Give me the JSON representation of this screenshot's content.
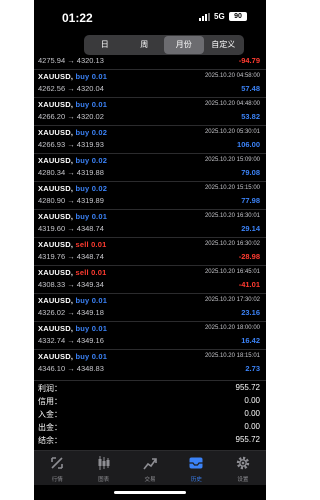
{
  "status_bar": {
    "time": "01:22",
    "network": "5G",
    "battery": "90"
  },
  "period_tabs": [
    {
      "label": "日",
      "active": false
    },
    {
      "label": "周",
      "active": false
    },
    {
      "label": "月份",
      "active": true
    },
    {
      "label": "自定义",
      "active": false
    }
  ],
  "top_partial": {
    "price": "4275.94 → 4320.13",
    "profit": "-94.79"
  },
  "trades": [
    {
      "symbol": "XAUUSD,",
      "side": "buy",
      "lot": "0.01",
      "date": "2025.10.20 04:58:00",
      "prices": "4262.56 → 4320.04",
      "profit": "57.48"
    },
    {
      "symbol": "XAUUSD,",
      "side": "buy",
      "lot": "0.01",
      "date": "2025.10.20 04:48:00",
      "prices": "4266.20 → 4320.02",
      "profit": "53.82"
    },
    {
      "symbol": "XAUUSD,",
      "side": "buy",
      "lot": "0.02",
      "date": "2025.10.20 05:30:01",
      "prices": "4266.93 → 4319.93",
      "profit": "106.00"
    },
    {
      "symbol": "XAUUSD,",
      "side": "buy",
      "lot": "0.02",
      "date": "2025.10.20 15:09:00",
      "prices": "4280.34 → 4319.88",
      "profit": "79.08"
    },
    {
      "symbol": "XAUUSD,",
      "side": "buy",
      "lot": "0.02",
      "date": "2025.10.20 15:15:00",
      "prices": "4280.90 → 4319.89",
      "profit": "77.98"
    },
    {
      "symbol": "XAUUSD,",
      "side": "buy",
      "lot": "0.01",
      "date": "2025.10.20 16:30:01",
      "prices": "4319.60 → 4348.74",
      "profit": "29.14"
    },
    {
      "symbol": "XAUUSD,",
      "side": "sell",
      "lot": "0.01",
      "date": "2025.10.20 16:30:02",
      "prices": "4319.76 → 4348.74",
      "profit": "-28.98"
    },
    {
      "symbol": "XAUUSD,",
      "side": "sell",
      "lot": "0.01",
      "date": "2025.10.20 16:45:01",
      "prices": "4308.33 → 4349.34",
      "profit": "-41.01"
    },
    {
      "symbol": "XAUUSD,",
      "side": "buy",
      "lot": "0.01",
      "date": "2025.10.20 17:30:02",
      "prices": "4326.02 → 4349.18",
      "profit": "23.16"
    },
    {
      "symbol": "XAUUSD,",
      "side": "buy",
      "lot": "0.01",
      "date": "2025.10.20 18:00:00",
      "prices": "4332.74 → 4349.16",
      "profit": "16.42"
    },
    {
      "symbol": "XAUUSD,",
      "side": "buy",
      "lot": "0.01",
      "date": "2025.10.20 18:15:01",
      "prices": "4346.10 → 4348.83",
      "profit": "2.73"
    }
  ],
  "summary": [
    {
      "label": "利润：",
      "value": "955.72"
    },
    {
      "label": "信用：",
      "value": "0.00"
    },
    {
      "label": "入金：",
      "value": "0.00"
    },
    {
      "label": "出金：",
      "value": "0.00"
    },
    {
      "label": "结余：",
      "value": "955.72"
    }
  ],
  "tabbar": [
    {
      "label": "行情",
      "icon": "quotes-icon",
      "active": false
    },
    {
      "label": "图表",
      "icon": "chart-icon",
      "active": false
    },
    {
      "label": "交易",
      "icon": "trade-icon",
      "active": false
    },
    {
      "label": "历史",
      "icon": "history-icon",
      "active": true
    },
    {
      "label": "设置",
      "icon": "settings-icon",
      "active": false
    }
  ],
  "colors": {
    "buy": "#3b82f6",
    "sell": "#ff3b30",
    "background": "#000000",
    "active_tab": "#3b82f6"
  }
}
